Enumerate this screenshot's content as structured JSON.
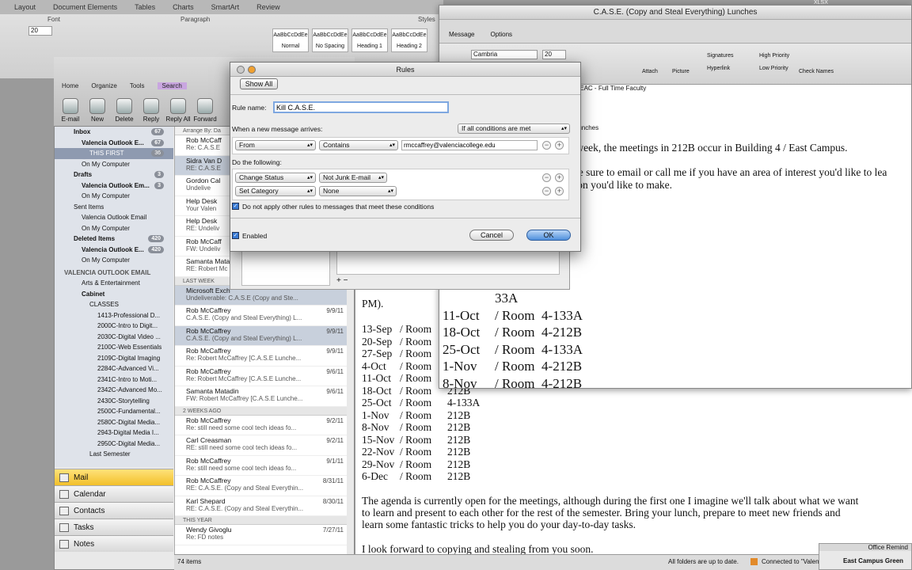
{
  "word": {
    "tabs": [
      "Layout",
      "Document Elements",
      "Tables",
      "Charts",
      "SmartArt",
      "Review"
    ],
    "groups": [
      "Font",
      "Paragraph",
      "Styles"
    ],
    "font_size": "20",
    "styles": [
      "Normal",
      "No Spacing",
      "Heading 1",
      "Heading 2"
    ],
    "style_sample": "AaBbCcDdEe"
  },
  "outlook": {
    "tabs": [
      "Home",
      "Organize",
      "Tools",
      "Search"
    ],
    "toolbar": [
      "E-mail",
      "New",
      "Delete",
      "Reply",
      "Reply All",
      "Forward"
    ],
    "folders": [
      {
        "label": "Inbox",
        "count": "67"
      },
      {
        "label": "Valencia Outlook E...",
        "count": "67"
      },
      {
        "label": "THIS FIRST",
        "count": "36"
      },
      {
        "label": "On My Computer",
        "count": ""
      },
      {
        "label": "Drafts",
        "count": "3"
      },
      {
        "label": "Valencia Outlook Em...",
        "count": "3"
      },
      {
        "label": "On My Computer",
        "count": ""
      },
      {
        "label": "Sent Items",
        "count": ""
      },
      {
        "label": "Valencia Outlook Email",
        "count": ""
      },
      {
        "label": "On My Computer",
        "count": ""
      },
      {
        "label": "Deleted Items",
        "count": "420"
      },
      {
        "label": "Valencia Outlook E...",
        "count": "420"
      },
      {
        "label": "On My Computer",
        "count": ""
      }
    ],
    "section_label": "VALENCIA OUTLOOK EMAIL",
    "sub_folders": [
      "Arts & Entertainment",
      "Cabinet",
      "CLASSES",
      "1413-Professional D...",
      "2000C-Intro to Digit...",
      "2030C-Digital Video ...",
      "2100C-Web Essentials",
      "2109C-Digital Imaging",
      "2284C-Advanced Vi...",
      "2341C-Intro to Moti...",
      "2342C-Advanced Mo...",
      "2430C-Storytelling",
      "2500C-Fundamental...",
      "2580C-Digital Media...",
      "2943-Digital Media I...",
      "2950C-Digital Media...",
      "Last Semester"
    ],
    "nav": [
      "Mail",
      "Calendar",
      "Contacts",
      "Tasks",
      "Notes"
    ],
    "arrange_label": "Arrange By: Da",
    "messages_top": [
      {
        "from": "Rob McCaff",
        "subject": "Re: C.A.S.E"
      },
      {
        "from": "Sidra Van D",
        "subject": "RE: C.A.S.E"
      },
      {
        "from": "Gordon Cal",
        "subject": "Undelive"
      },
      {
        "from": "Help Desk",
        "subject": "Your Valen"
      },
      {
        "from": "Help Desk",
        "subject": "RE: Undeliv"
      },
      {
        "from": "Rob McCaff",
        "subject": "FW: Undeliv"
      },
      {
        "from": "Samanta Matadi",
        "subject": "RE: Robert Mc"
      }
    ],
    "group_last_week": "LAST WEEK",
    "messages_last_week": [
      {
        "from": "Microsoft Exch",
        "subject": "Undeliverable: C.A.S.E (Copy and Ste...",
        "date": ""
      },
      {
        "from": "Rob McCaffrey",
        "subject": "C.A.S.E. (Copy and Steal Everything) L...",
        "date": "9/9/11"
      },
      {
        "from": "Rob McCaffrey",
        "subject": "C.A.S.E. (Copy and Steal Everything) L...",
        "date": "9/9/11"
      },
      {
        "from": "Rob McCaffrey",
        "subject": "Re: Robert McCaffrey [C.A.S.E Lunche...",
        "date": "9/9/11"
      },
      {
        "from": "Rob McCaffrey",
        "subject": "Re: Robert McCaffrey [C.A.S.E Lunche...",
        "date": "9/6/11"
      },
      {
        "from": "Samanta Matadin",
        "subject": "FW: Robert McCaffrey [C.A.S.E Lunche...",
        "date": "9/6/11"
      }
    ],
    "group_two_weeks": "2 WEEKS AGO",
    "messages_two_weeks": [
      {
        "from": "Rob McCaffrey",
        "subject": "Re: still need some cool tech ideas fo...",
        "date": "9/2/11"
      },
      {
        "from": "Carl Creasman",
        "subject": "RE: still need some cool tech ideas fo...",
        "date": "9/2/11"
      },
      {
        "from": "Rob McCaffrey",
        "subject": "Re: still need some cool tech ideas fo...",
        "date": "9/1/11"
      },
      {
        "from": "Rob McCaffrey",
        "subject": "RE: C.A.S.E. (Copy and Steal Everythin...",
        "date": "8/31/11"
      },
      {
        "from": "Karl Shepard",
        "subject": "RE: C.A.S.E. (Copy and Steal Everythin...",
        "date": "8/30/11"
      }
    ],
    "group_this_year": "THIS YEAR",
    "messages_this_year": [
      {
        "from": "Wendy Givoglu",
        "subject": "Re: FD notes",
        "date": "7/27/11"
      }
    ],
    "status_items": "74 items",
    "status_sync": "All folders are up to date.",
    "status_connected": "Connected to \"Valen"
  },
  "compose": {
    "title": "C.A.S.E. (Copy and Steal Everything) Lunches",
    "tabs": [
      "Message",
      "Options"
    ],
    "font": "Cambria",
    "size": "20",
    "ribbon_labels": [
      "Attach",
      "Picture",
      "Signatures",
      "Hyperlink",
      "High Priority",
      "Low Priority",
      "Check Names"
    ],
    "to_line": "L - EAC - Full Time Faculty",
    "subject_suffix": ") Lunches",
    "line1": "st week, the meetings in 212B occur in Building 4 / East Campus.",
    "line2": ". Be sure to email or call me if you have an area of interest you'd like to lea",
    "line3": "ntion you'd like to make.",
    "schedule": [
      {
        "date": "",
        "room": "33A"
      },
      {
        "date": "",
        "room": "33A"
      },
      {
        "date": "",
        "room": "33A"
      },
      {
        "date": "11-Oct",
        "room": "/ Room  4-133A"
      },
      {
        "date": "18-Oct",
        "room": "/ Room  4-212B"
      },
      {
        "date": "25-Oct",
        "room": "/ Room  4-133A"
      },
      {
        "date": "1-Nov",
        "room": "/ Room  4-212B"
      },
      {
        "date": "8-Nov",
        "room": "/ Room  4-212B"
      }
    ]
  },
  "reading": {
    "pm_text": "PM).",
    "schedule": [
      {
        "date": "13-Sep",
        "room": "/ Room",
        "num": ""
      },
      {
        "date": "20-Sep",
        "room": "/ Room",
        "num": ""
      },
      {
        "date": "27-Sep",
        "room": "/ Room",
        "num": ""
      },
      {
        "date": "4-Oct",
        "room": "/ Room",
        "num": ""
      },
      {
        "date": "11-Oct",
        "room": "/ Room",
        "num": ""
      },
      {
        "date": "18-Oct",
        "room": "/ Room",
        "num": "212B"
      },
      {
        "date": "25-Oct",
        "room": "/ Room",
        "num": "4-133A"
      },
      {
        "date": "1-Nov",
        "room": "/ Room",
        "num": "212B"
      },
      {
        "date": "8-Nov",
        "room": "/ Room",
        "num": "212B"
      },
      {
        "date": "15-Nov",
        "room": "/ Room",
        "num": "212B"
      },
      {
        "date": "22-Nov",
        "room": "/ Room",
        "num": "212B"
      },
      {
        "date": "29-Nov",
        "room": "/ Room",
        "num": "212B"
      },
      {
        "date": "6-Dec",
        "room": "/ Room",
        "num": "212B"
      }
    ],
    "para1": "The agenda is currently open for the meetings, although during the first one I imagine we'll talk about what we want",
    "para2": "to learn and present to each other for the rest of the semester. Bring your lunch, prepare to meet new friends and",
    "para3": "learn some fantastic tricks to help you do your day-to-day tasks.",
    "para4": "I look forward to copying and stealing from you soon."
  },
  "rules": {
    "title": "Rules",
    "show_all": "Show All",
    "rule_name_label": "Rule name:",
    "rule_name_value": "Kill C.A.S.E.",
    "when_label": "When a new message arrives:",
    "conditions_mode": "If all conditions are met",
    "cond_field": "From",
    "cond_op": "Contains",
    "cond_value": "rmccaffrey@valenciacollege.edu",
    "do_label": "Do the following:",
    "action1": "Change Status",
    "action1_val": "Not Junk E-mail",
    "action2": "Set Category",
    "action2_val": "None",
    "no_other_rules": "Do not apply other rules to messages that meet these conditions",
    "enabled": "Enabled",
    "cancel": "Cancel",
    "ok": "OK"
  },
  "reminders": {
    "title": "Office Remind",
    "item": "East Campus Green"
  },
  "misc": {
    "xlsx": "XLSX"
  }
}
